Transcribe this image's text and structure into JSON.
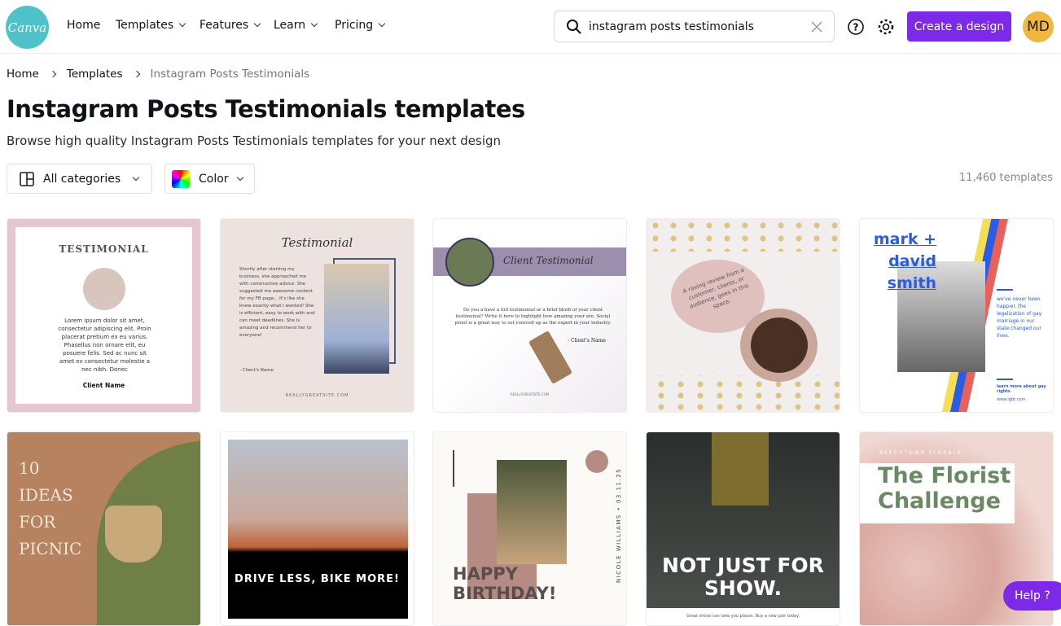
{
  "header": {
    "logo": "Canva",
    "nav": [
      {
        "label": "Home"
      },
      {
        "label": "Templates"
      },
      {
        "label": "Features"
      },
      {
        "label": "Learn"
      },
      {
        "label": "Pricing"
      }
    ],
    "search_value": "instagram posts testimonials",
    "create_label": "Create a design",
    "avatar_initials": "MD",
    "brand_color": "#7d2ae8"
  },
  "breadcrumb": [
    "Home",
    "Templates",
    "Instagram Posts Testimonials"
  ],
  "page": {
    "title": "Instagram Posts Testimonials templates",
    "subtitle": "Browse high quality Instagram Posts Testimonials templates for your next design"
  },
  "filters": {
    "categories": "All categories",
    "color": "Color",
    "count": "11,460 templates"
  },
  "templates": [
    {
      "title": "TESTIMONIAL",
      "body": "Lorem ipsum dolor sit amet, consectetur adipiscing elit. Proin placerat pretium ex eu varius. Phasellus non ornare elit, eu posuere felis. Sed ac nunc sit amet ex consectetur molestie a nec nibh. Donec",
      "name": "Client Name"
    },
    {
      "title": "Testimonial",
      "body": "Shortly after starting my business, she approached me with constructive advice. She suggested me awesome content for my FB page... It's like she knew exactly what I wanted! She is efficient, easy to work with and can meet deadlines. She is amazing and recommend her to everyone!",
      "name": "- Client's Name",
      "site": "REALLYGREATSITE.COM"
    },
    {
      "title": "Client Testimonial",
      "body": "Do you a have a full testimonial or a brief blurb of your client testimonial? Write it here to highlight how amazing your are. Social proof is a great way to set yourself up as the expert in your industry.",
      "name": "- Client's Name",
      "site": "REALLYGREATSITE.COM"
    },
    {
      "body": "A raving review from a customer, clients, or audience, goes in this space."
    },
    {
      "title": "mark + david smith",
      "body": "we've never been happier. the legalization of gay marriage in our state changed our lives.",
      "link": "learn more about gay rights",
      "site": "www.lgbt.com"
    },
    {
      "title": "10 IDEAS FOR PICNIC"
    },
    {
      "title": "DRIVE LESS, BIKE MORE!"
    },
    {
      "title": "HAPPY BIRTHDAY!",
      "side": "NICOLE WILLIAMS • 03.11.25"
    },
    {
      "title": "NOT JUST FOR SHOW.",
      "body": "Great shoes can take you places. Buy a new pair today."
    },
    {
      "kicker": "BEECHTOWN FLORALS",
      "title": "The Florist Challenge"
    }
  ],
  "help": {
    "label": "Help ?"
  }
}
